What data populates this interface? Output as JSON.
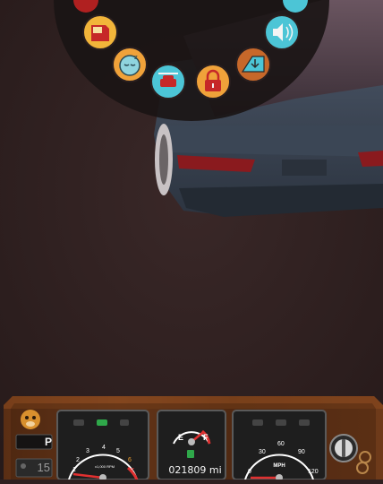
{
  "radial_menu": {
    "buttons": [
      {
        "name": "radial-door-button",
        "icon": "car-door-icon",
        "color": "#f2b53a"
      },
      {
        "name": "radial-sleep-button",
        "icon": "sleep-face-icon",
        "color": "#f0a23a"
      },
      {
        "name": "radial-car-service-button",
        "icon": "car-wrench-icon",
        "color": "#4cc5d6"
      },
      {
        "name": "radial-lock-button",
        "icon": "padlock-icon",
        "color": "#f0a23a"
      },
      {
        "name": "radial-window-button",
        "icon": "window-down-icon",
        "color": "#c7682a"
      },
      {
        "name": "radial-horn-button",
        "icon": "speaker-icon",
        "color": "#4cc5d6"
      }
    ]
  },
  "dashboard": {
    "left_panel": {
      "character_icon": "monkey-icon",
      "gear": "P",
      "odometer_badge": "15"
    },
    "tachometer": {
      "ticks": [
        "1",
        "2",
        "3",
        "4",
        "5",
        "6",
        "7"
      ],
      "unit_label": "x1,000 RPM",
      "warning_icons": [
        "engine-icon",
        "battery-icon",
        "oil-icon"
      ]
    },
    "fuel_gauge": {
      "empty_label": "E",
      "full_label": "F",
      "fuel_level": 0.78,
      "fuel_icon": "fuel-pump-icon",
      "odometer": "021809 mi"
    },
    "speedometer": {
      "ticks": [
        "0",
        "30",
        "60",
        "90",
        "120"
      ],
      "unit_label": "MPH",
      "warning_icons": [
        "wiper-icon",
        "defrost-icon",
        "headlight-icon"
      ]
    },
    "ignition_icon": "ignition-key-icon",
    "keys_icon": "keychain-icon"
  }
}
